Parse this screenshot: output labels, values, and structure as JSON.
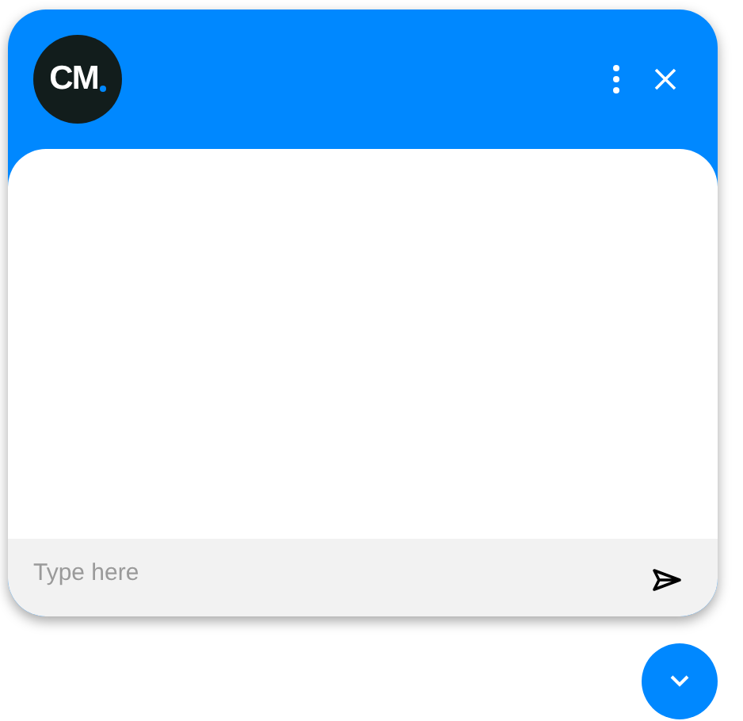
{
  "header": {
    "logo": {
      "text": "CM"
    }
  },
  "composer": {
    "placeholder": "Type here"
  }
}
